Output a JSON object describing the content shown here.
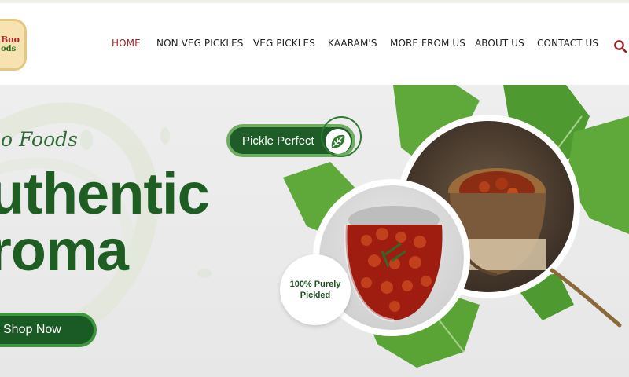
{
  "logo": {
    "line1": "Boo",
    "line2": "ods"
  },
  "nav": {
    "items": [
      {
        "label": "HOME",
        "active": true
      },
      {
        "label": "NON VEG PICKLES",
        "active": false
      },
      {
        "label": "VEG PICKLES",
        "active": false
      },
      {
        "label": "KAARAM'S",
        "active": false
      },
      {
        "label": "MORE FROM US",
        "active": false
      },
      {
        "label": "ABOUT US",
        "active": false
      },
      {
        "label": "CONTACT US",
        "active": false
      }
    ],
    "search_icon": "search-icon"
  },
  "hero": {
    "brand_script": "oo Foods",
    "headline_line1": "uthentic",
    "headline_line2": "roma",
    "cta_label": "Shop Now",
    "pill_label": "Pickle Perfect",
    "pill_icon": "monstera-leaf-icon",
    "badge_line1": "100% Purely",
    "badge_line2": "Pickled"
  },
  "colors": {
    "accent_red": "#9b2226",
    "brand_green": "#1f5e23",
    "button_green": "#1a5a25",
    "leaf_green": "#5fa83a"
  }
}
